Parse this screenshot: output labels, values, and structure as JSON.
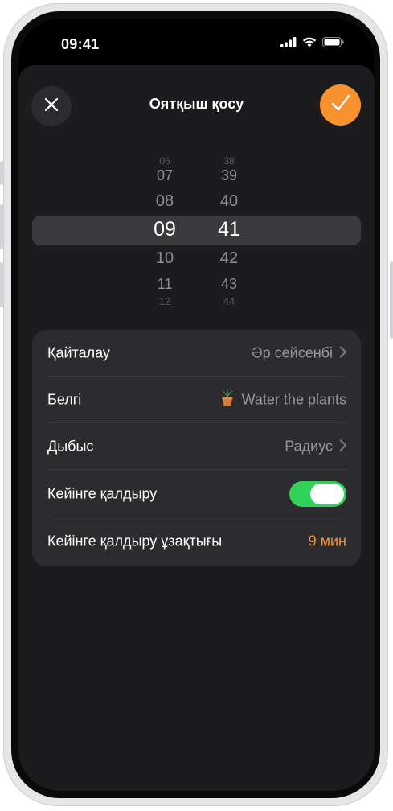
{
  "status": {
    "time": "09:41"
  },
  "header": {
    "title": "Оятқыш қосу"
  },
  "picker": {
    "hours": [
      "06",
      "07",
      "08",
      "09",
      "10",
      "11",
      "12"
    ],
    "minutes": [
      "38",
      "39",
      "40",
      "41",
      "42",
      "43",
      "44"
    ],
    "selected_hour": "09",
    "selected_minute": "41"
  },
  "settings": {
    "repeat": {
      "label": "Қайталау",
      "value": "Әр сейсенбі"
    },
    "tag": {
      "label": "Белгі",
      "value": "Water the plants"
    },
    "sound": {
      "label": "Дыбыс",
      "value": "Радиус"
    },
    "snooze": {
      "label": "Кейінге қалдыру",
      "enabled": true
    },
    "snooze_duration": {
      "label": "Кейінге қалдыру ұзақтығы",
      "value": "9 мин"
    }
  },
  "colors": {
    "accent": "#f7922e",
    "toggle_on": "#30d158"
  }
}
